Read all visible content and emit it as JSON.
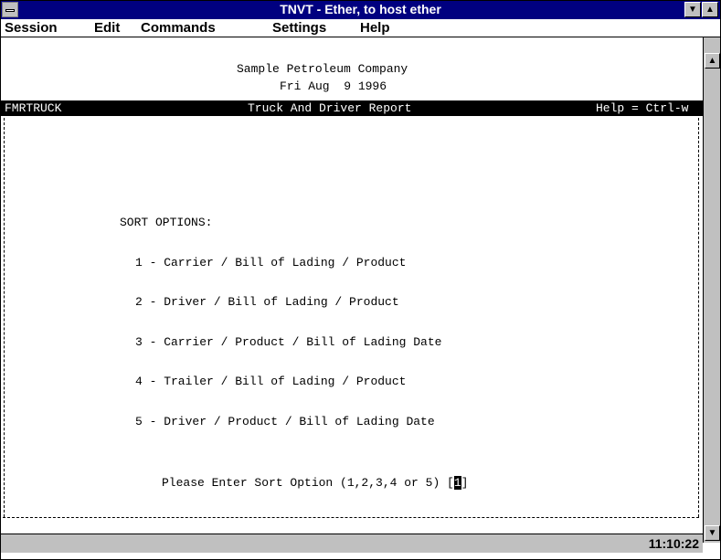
{
  "window": {
    "title": "TNVT - Ether, to host ether"
  },
  "menu": [
    {
      "label": "Session"
    },
    {
      "label": "Edit"
    },
    {
      "label": "Commands"
    },
    {
      "label": "Settings"
    },
    {
      "label": "Help"
    }
  ],
  "terminal": {
    "company": "Sample Petroleum Company",
    "date": "Fri Aug  9 1996",
    "program": "FMRTRUCK",
    "report_title": "Truck And Driver Report",
    "help_hint": "Help = Ctrl-w",
    "sort_heading": "SORT OPTIONS:",
    "options": [
      "1 - Carrier / Bill of Lading / Product",
      "2 - Driver / Bill of Lading / Product",
      "3 - Carrier / Product / Bill of Lading Date",
      "4 - Trailer / Bill of Lading / Product",
      "5 - Driver / Product / Bill of Lading Date"
    ],
    "prompt": "Please Enter Sort Option (1,2,3,4 or 5) [",
    "input_value": "1",
    "prompt_close": "]"
  },
  "status": {
    "time": "11:10:22"
  }
}
